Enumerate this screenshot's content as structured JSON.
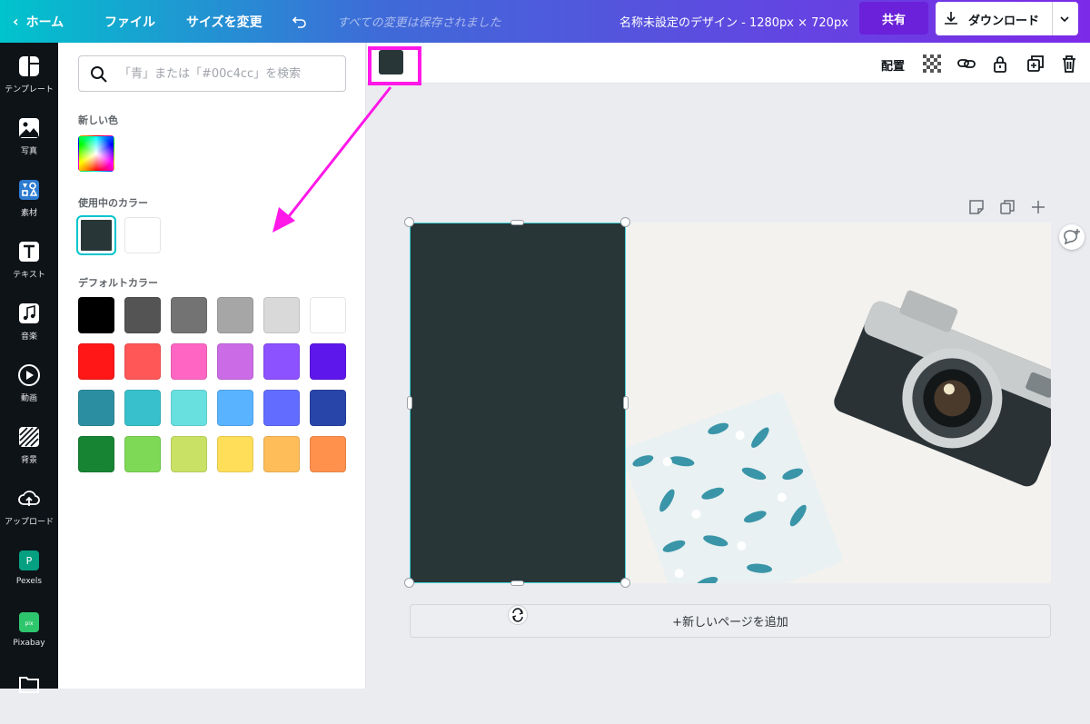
{
  "topbar": {
    "home": "ホーム",
    "file": "ファイル",
    "resize": "サイズを変更",
    "saved_status": "すべての変更は保存されました",
    "design_title": "名称未設定のデザイン - 1280px × 720px",
    "share": "共有",
    "download": "ダウンロード"
  },
  "sidebar": {
    "items": [
      {
        "label": "テンプレート",
        "icon": "template-icon"
      },
      {
        "label": "写真",
        "icon": "photo-icon"
      },
      {
        "label": "素材",
        "icon": "elements-icon"
      },
      {
        "label": "テキスト",
        "icon": "text-icon"
      },
      {
        "label": "音楽",
        "icon": "music-icon"
      },
      {
        "label": "動画",
        "icon": "video-icon"
      },
      {
        "label": "背景",
        "icon": "background-icon"
      },
      {
        "label": "アップロード",
        "icon": "upload-icon"
      },
      {
        "label": "Pexels",
        "icon": "pexels-icon"
      },
      {
        "label": "Pixabay",
        "icon": "pixabay-icon"
      },
      {
        "label": "",
        "icon": "folder-icon"
      }
    ]
  },
  "color_panel": {
    "search_placeholder": "「青」または「#00c4cc」を検索",
    "new_color_label": "新しい色",
    "in_use_label": "使用中のカラー",
    "in_use_colors": [
      "#283638",
      "#ffffff"
    ],
    "default_label": "デフォルトカラー",
    "default_colors": [
      "#000000",
      "#545454",
      "#737373",
      "#a6a6a6",
      "#d9d9d9",
      "#ffffff",
      "#ff1616",
      "#ff5757",
      "#ff66c4",
      "#cb6ce6",
      "#8c52ff",
      "#5e17eb",
      "#2c8fa1",
      "#38c1cc",
      "#69e0e0",
      "#5ab3ff",
      "#626dff",
      "#2846a9",
      "#178434",
      "#7ed957",
      "#c9e265",
      "#ffde59",
      "#ffbd59",
      "#ff914d"
    ]
  },
  "toolbar": {
    "current_color": "#283638",
    "arrange": "配置"
  },
  "canvas": {
    "rect_color": "#283638",
    "add_page": "+新しいページを追加"
  },
  "annotation": {
    "highlight_color": "#ff18e8"
  }
}
